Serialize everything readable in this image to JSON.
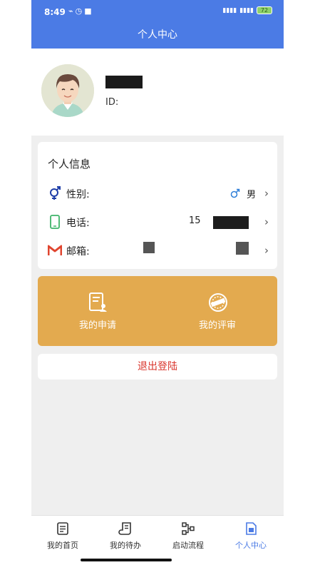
{
  "status_bar": {
    "time": "8:49",
    "battery": "72"
  },
  "header": {
    "title": "个人中心"
  },
  "profile": {
    "name": "",
    "id_label": "ID:"
  },
  "info": {
    "title": "个人信息",
    "gender_label": "性别:",
    "gender_value": "男",
    "phone_label": "电话:",
    "phone_value": "15",
    "email_label": "邮箱:"
  },
  "actions": {
    "my_application": "我的申请",
    "my_review": "我的评审"
  },
  "logout_label": "退出登陆",
  "tabs": [
    {
      "label": "我的首页",
      "icon": "document-list-icon"
    },
    {
      "label": "我的待办",
      "icon": "todo-scroll-icon"
    },
    {
      "label": "启动流程",
      "icon": "workflow-icon"
    },
    {
      "label": "个人中心",
      "icon": "profile-doc-icon",
      "active": true
    }
  ],
  "colors": {
    "header": "#4b7be5",
    "action_card": "#e3aa4f",
    "logout_text": "#d9342b",
    "active_tab": "#4b7be5"
  }
}
